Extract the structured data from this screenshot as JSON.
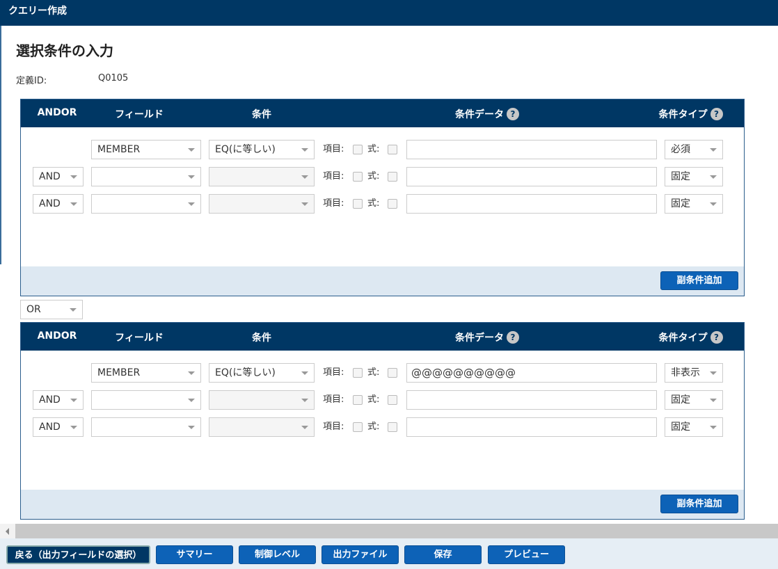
{
  "window": {
    "title": "クエリー作成"
  },
  "page": {
    "title": "選択条件の入力",
    "def_id_label": "定義ID:",
    "def_id_value": "Q0105"
  },
  "headers": {
    "andor": "ANDOR",
    "field": "フィールド",
    "condition": "条件",
    "cond_data": "条件データ",
    "cond_type": "条件タイプ",
    "help": "?"
  },
  "labels": {
    "item": "項目:",
    "expr": "式:"
  },
  "groups": [
    {
      "rows": [
        {
          "andor": "",
          "field": "MEMBER",
          "condition": "EQ(に等しい)",
          "data": "",
          "type": "必須"
        },
        {
          "andor": "AND",
          "field": "",
          "condition": "",
          "data": "",
          "type": "固定"
        },
        {
          "andor": "AND",
          "field": "",
          "condition": "",
          "data": "",
          "type": "固定"
        }
      ],
      "add_button": "副条件追加"
    },
    {
      "rows": [
        {
          "andor": "",
          "field": "MEMBER",
          "condition": "EQ(に等しい)",
          "data": "@@@@@@@@@@",
          "type": "非表示"
        },
        {
          "andor": "AND",
          "field": "",
          "condition": "",
          "data": "",
          "type": "固定"
        },
        {
          "andor": "AND",
          "field": "",
          "condition": "",
          "data": "",
          "type": "固定"
        }
      ],
      "add_button": "副条件追加"
    }
  ],
  "between_op": "OR",
  "buttons": {
    "back": "戻る（出力フィールドの選択）",
    "summary": "サマリー",
    "control_level": "制御レベル",
    "output_file": "出力ファイル",
    "save": "保存",
    "preview": "プレビュー"
  }
}
